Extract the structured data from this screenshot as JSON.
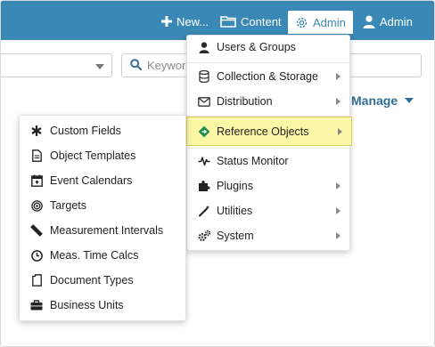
{
  "topbar": {
    "new_label": "New...",
    "content_label": "Content",
    "admin_label": "Admin",
    "user_label": "Admin",
    "colors": {
      "bar": "#3a88b5",
      "text": "#ffffff"
    }
  },
  "search": {
    "placeholder": "Keywor"
  },
  "manage": {
    "label": "Manage"
  },
  "admin_menu": {
    "items": [
      {
        "label": "Users & Groups",
        "icon": "user-icon",
        "has_submenu": false
      },
      {
        "label": "Collection & Storage",
        "icon": "database-icon",
        "has_submenu": true
      },
      {
        "label": "Distribution",
        "icon": "envelope-icon",
        "has_submenu": true
      },
      {
        "label": "Reference Objects",
        "icon": "diamond-arrow-icon",
        "has_submenu": true,
        "highlighted": true
      },
      {
        "label": "Status Monitor",
        "icon": "pulse-icon",
        "has_submenu": false
      },
      {
        "label": "Plugins",
        "icon": "puzzle-icon",
        "has_submenu": true
      },
      {
        "label": "Utilities",
        "icon": "magic-wand-icon",
        "has_submenu": true
      },
      {
        "label": "System",
        "icon": "cogs-icon",
        "has_submenu": true
      }
    ],
    "highlight_color": "#fbf7a6"
  },
  "reference_submenu": {
    "items": [
      {
        "label": "Custom Fields",
        "icon": "asterisk-icon"
      },
      {
        "label": "Object Templates",
        "icon": "document-icon"
      },
      {
        "label": "Event Calendars",
        "icon": "calendar-icon"
      },
      {
        "label": "Targets",
        "icon": "target-icon"
      },
      {
        "label": "Measurement Intervals",
        "icon": "ruler-icon"
      },
      {
        "label": "Meas. Time Calcs",
        "icon": "clock-icon"
      },
      {
        "label": "Document Types",
        "icon": "file-icon"
      },
      {
        "label": "Business Units",
        "icon": "briefcase-icon"
      }
    ]
  }
}
